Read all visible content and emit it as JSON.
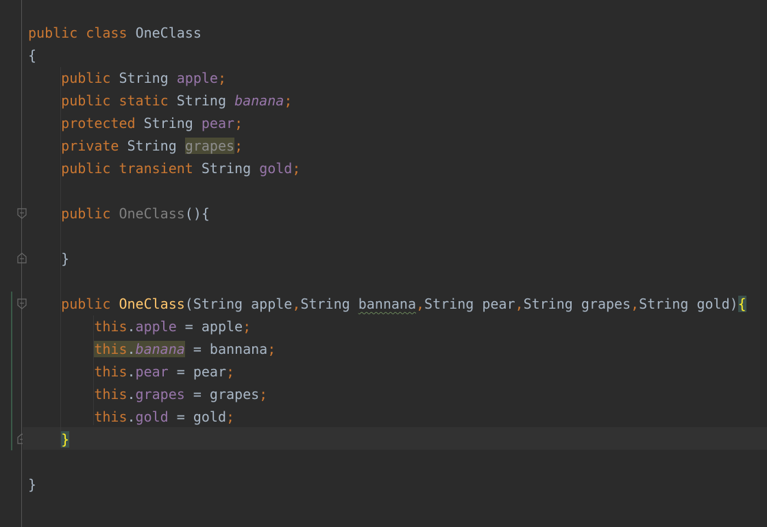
{
  "editor": {
    "colors": {
      "background": "#2b2b2b",
      "keyword": "#cc7832",
      "field": "#9876aa",
      "default_text": "#a9b7c6",
      "method_declaration": "#ffc66d",
      "brace_match": "#ffef28"
    },
    "gutter": {
      "fold_icons": [
        "fold-start-icon",
        "fold-end-icon",
        "fold-start-icon",
        "fold-end-icon"
      ]
    },
    "code": {
      "line1": {
        "kw_public": "public",
        "kw_class": "class",
        "class_name": "OneClass"
      },
      "line2": {
        "open_brace": "{"
      },
      "line3": {
        "kw_public": "public",
        "type": "String",
        "field": "apple",
        "semi": ";"
      },
      "line4": {
        "kw_public": "public",
        "kw_static": "static",
        "type": "String",
        "field": "banana",
        "semi": ";"
      },
      "line5": {
        "kw_protected": "protected",
        "type": "String",
        "field": "pear",
        "semi": ";"
      },
      "line6": {
        "kw_private": "private",
        "type": "String",
        "field": "grapes",
        "semi": ";"
      },
      "line7": {
        "kw_public": "public",
        "kw_transient": "transient",
        "type": "String",
        "field": "gold",
        "semi": ";"
      },
      "line9": {
        "kw_public": "public",
        "ctor_name": "OneClass",
        "rest": "(){"
      },
      "line11": {
        "close_brace": "}"
      },
      "line13": {
        "kw_public": "public",
        "ctor_name": "OneClass",
        "open_paren": "(",
        "p1_type": "String",
        "p1_name": "apple",
        "comma1": ",",
        "p2_type": "String",
        "p2_name": "bannana",
        "comma2": ",",
        "p3_type": "String",
        "p3_name": "pear",
        "comma3": ",",
        "p4_type": "String",
        "p4_name": "grapes",
        "comma4": ",",
        "p5_type": "String",
        "p5_name": "gold",
        "close_paren": ")",
        "open_brace": "{"
      },
      "line14": {
        "this": "this",
        "dot": ".",
        "field": "apple",
        "assign": " = ",
        "value": "apple",
        "semi": ";"
      },
      "line15": {
        "this": "this",
        "dot": ".",
        "field": "banana",
        "assign": " = ",
        "value": "bannana",
        "semi": ";"
      },
      "line16": {
        "this": "this",
        "dot": ".",
        "field": "pear",
        "assign": " = ",
        "value": "pear",
        "semi": ";"
      },
      "line17": {
        "this": "this",
        "dot": ".",
        "field": "grapes",
        "assign": " = ",
        "value": "grapes",
        "semi": ";"
      },
      "line18": {
        "this": "this",
        "dot": ".",
        "field": "gold",
        "assign": " = ",
        "value": "gold",
        "semi": ";"
      },
      "line19": {
        "close_brace": "}"
      },
      "line21": {
        "close_brace": "}"
      }
    }
  }
}
